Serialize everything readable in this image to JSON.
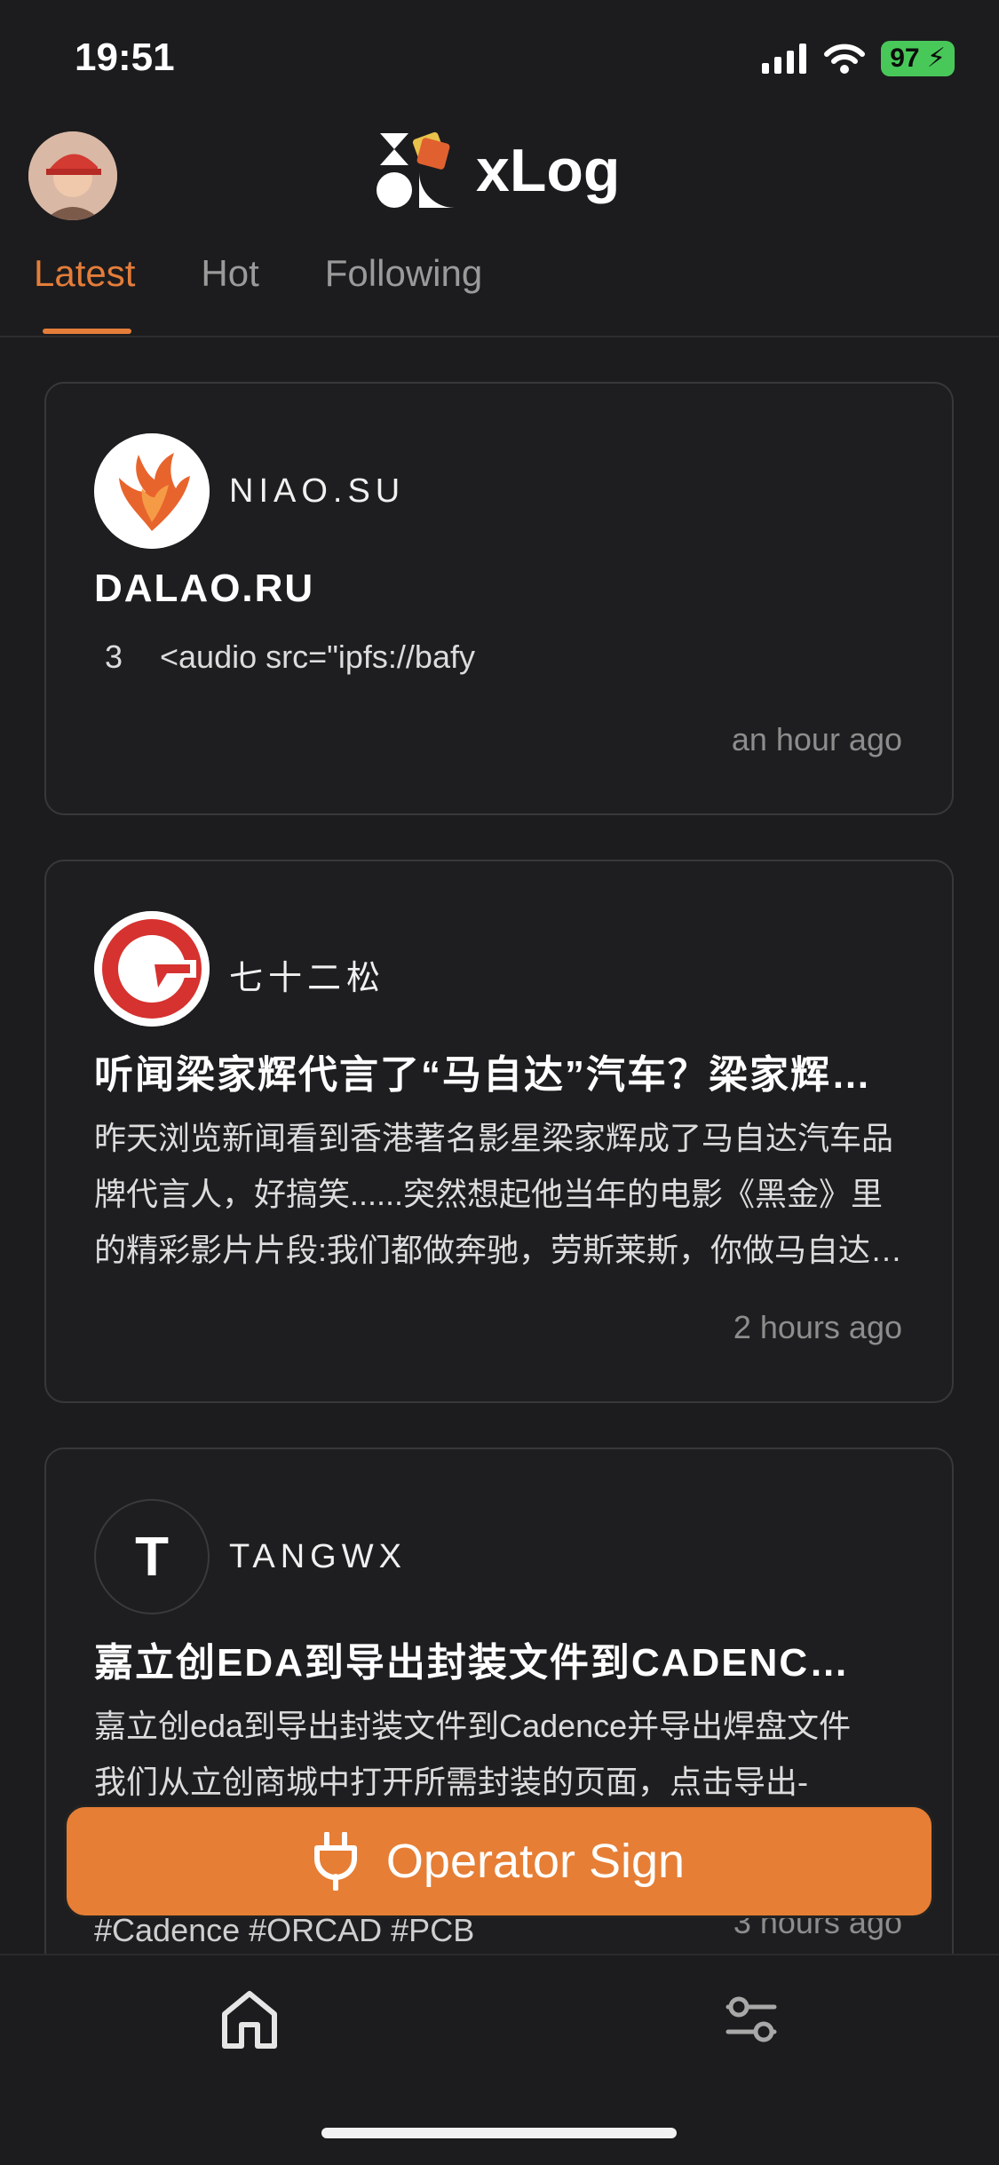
{
  "status": {
    "time": "19:51",
    "battery": "97"
  },
  "header": {
    "title": "xLog"
  },
  "tabs": [
    {
      "label": "Latest",
      "active": true
    },
    {
      "label": "Hot"
    },
    {
      "label": "Following"
    }
  ],
  "posts": [
    {
      "author": "NIAO.SU",
      "title": "DALAO.RU",
      "excerpt_num": "3",
      "excerpt": "<audio src=\"ipfs://bafy",
      "time": "an hour ago"
    },
    {
      "author": "七十二松",
      "title": "听闻梁家辉代言了“马自达”汽车？梁家辉…",
      "excerpt_line1": "昨天浏览新闻看到香港著名影星梁家辉成了马自达汽车品",
      "excerpt_line2": "牌代言人，好搞笑......突然想起他当年的电影《黑金》里",
      "excerpt_line3": "的精彩影片片段:我们都做奔驰，劳斯莱斯，你做马自达…",
      "time": "2 hours ago"
    },
    {
      "author": "TANGWX",
      "avatar_letter": "T",
      "title": "嘉立创EDA到导出封装文件到CADENC…",
      "excerpt_line1": "嘉立创eda到导出封装文件到Cadence并导出焊盘文件",
      "excerpt_line2": "我们从立创商城中打开所需封装的页面，点击导出-",
      "tags": "#Cadence  #ORCAD  #PCB",
      "time": "3 hours ago"
    }
  ],
  "operator_button": {
    "label": "Operator Sign",
    "icon": "plug-icon"
  },
  "bottom_nav": [
    {
      "icon": "home-icon"
    },
    {
      "icon": "settings-sliders-icon"
    }
  ],
  "colors": {
    "accent": "#e67e35",
    "background": "#1c1c1e",
    "battery": "#49c85a"
  }
}
